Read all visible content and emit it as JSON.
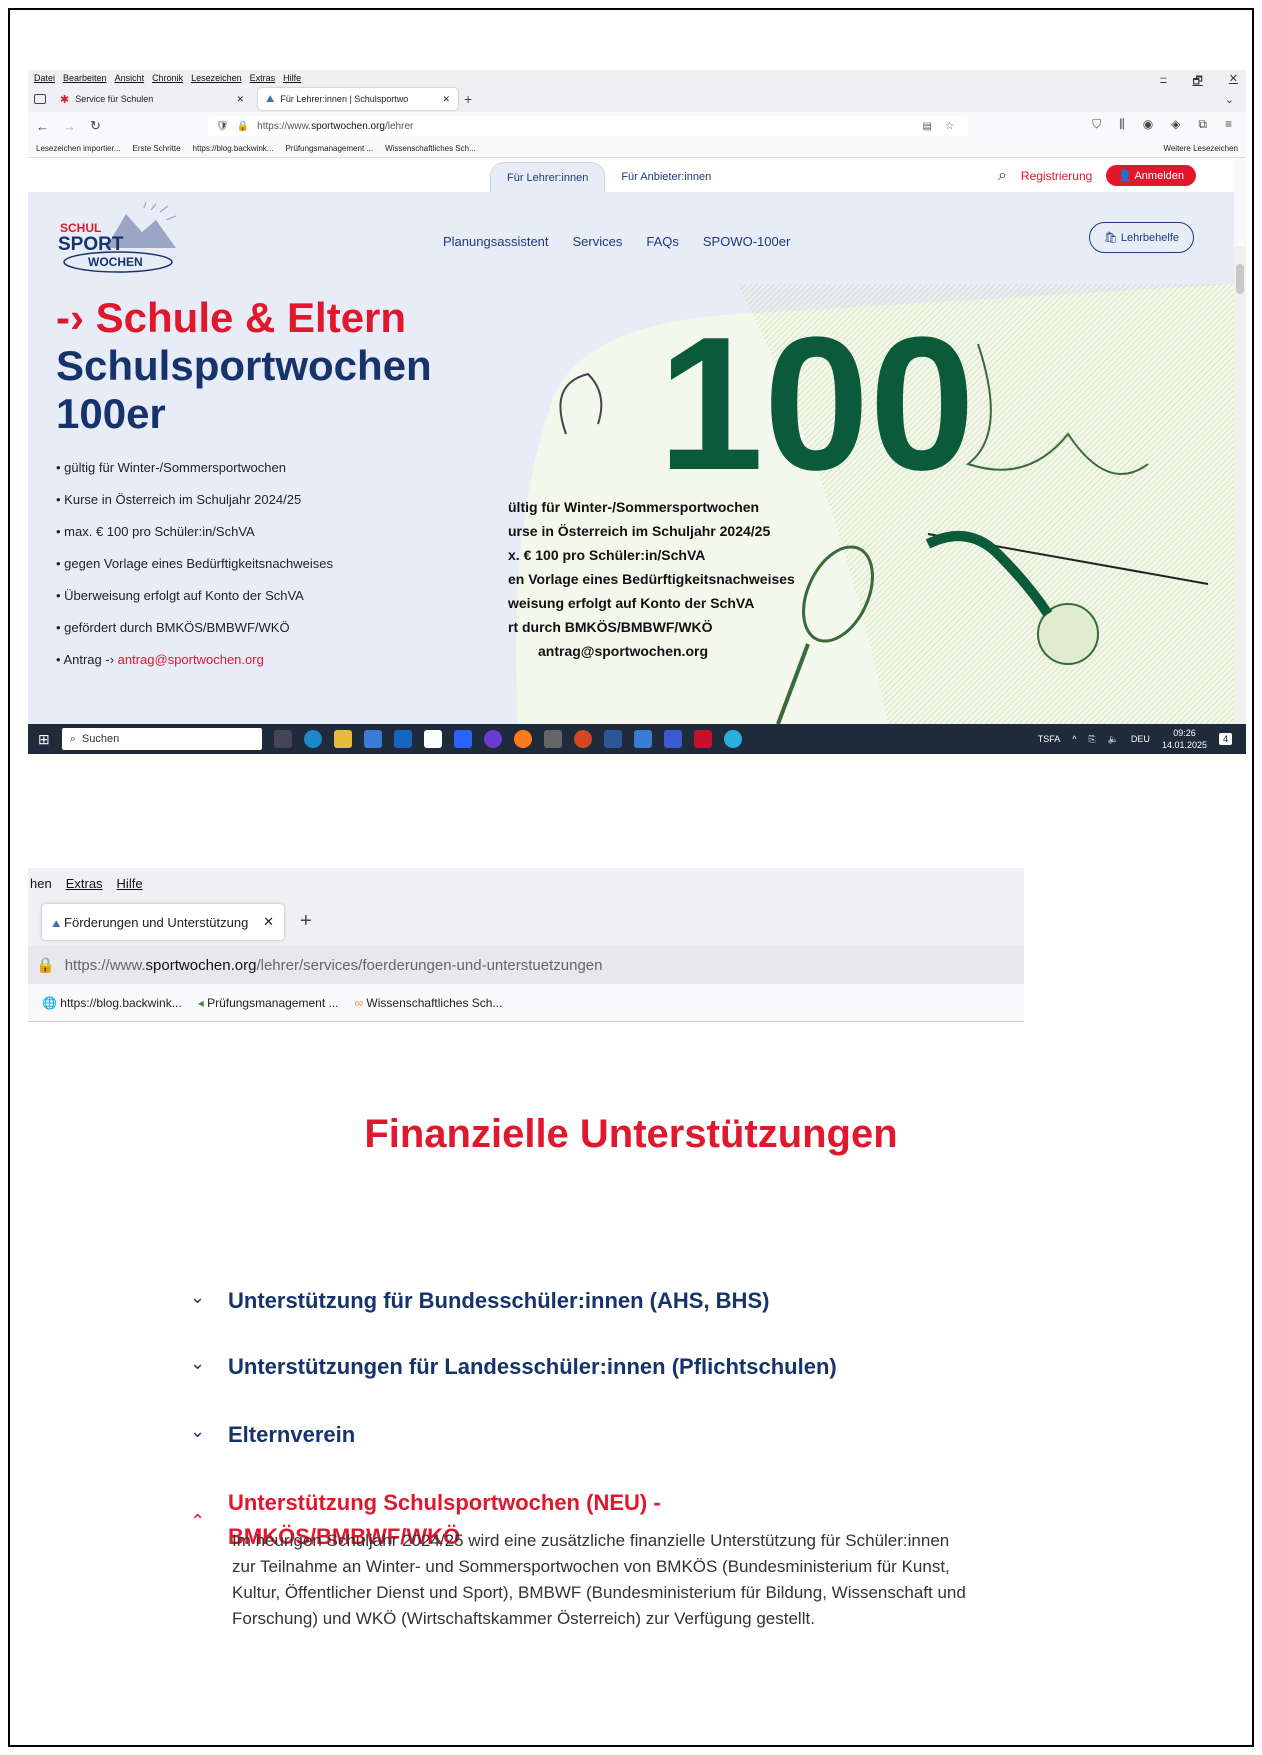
{
  "shot1": {
    "menu": [
      "Datei",
      "Bearbeiten",
      "Ansicht",
      "Chronik",
      "Lesezeichen",
      "Extras",
      "Hilfe"
    ],
    "window_controls": [
      "–",
      "🗗",
      "✕"
    ],
    "tabs": [
      {
        "label": "Service für Schulen"
      },
      {
        "label": "Für Lehrer:innen | Schulsportwo"
      }
    ],
    "url_prefix": "https://www.",
    "url_domain": "sportwochen.org",
    "url_path": "/lehrer",
    "bookmarks": [
      "Lesezeichen importier...",
      "Erste Schritte",
      "https://blog.backwink...",
      "Prüfungsmanagement ...",
      "Wissenschaftliches Sch..."
    ],
    "bookmarks_more": "Weitere Lesezeichen",
    "site": {
      "segment_active": "Für Lehrer:innen",
      "segment_other": "Für Anbieter:innen",
      "register": "Registrierung",
      "login": "Anmelden",
      "logo_line1": "SCHUL",
      "logo_line2": "SPORT",
      "logo_line3": "WOCHEN",
      "nav": [
        "Planungsassistent",
        "Services",
        "FAQs",
        "SPOWO-100er"
      ],
      "lehrbehelfe": "Lehrbehelfe",
      "hero_red": "-› Schule & Eltern",
      "hero_blue_1": "Schulsportwochen",
      "hero_blue_2": "100er",
      "bullets": [
        "gültig für Winter-/Sommersportwochen",
        "Kurse in Österreich im Schuljahr 2024/25",
        "max. € 100 pro Schüler:in/SchVA",
        "gegen Vorlage eines Bedürftigkeitsnachweises",
        "Überweisung erfolgt auf Konto der SchVA",
        "gefördert durch BMKÖS/BMBWF/WKÖ"
      ],
      "bullet_last_prefix": "Antrag -› ",
      "bullet_last_link": "antrag@sportwochen.org",
      "voucher_number": "100",
      "voucher_lines": [
        "ültig für Winter-/Sommersportwochen",
        "urse in Österreich im Schuljahr 2024/25",
        "x. € 100 pro Schüler:in/SchVA",
        "en Vorlage eines Bedürftigkeitsnachweises",
        "weisung erfolgt auf Konto der SchVA",
        "rt durch BMKÖS/BMBWF/WKÖ",
        "antrag@sportwochen.org"
      ]
    },
    "taskbar": {
      "search": "Suchen",
      "tray_label": "TSFA",
      "lang": "DEU",
      "time": "09:26",
      "date": "14.01.2025",
      "notif": "4"
    }
  },
  "shot2": {
    "menu": [
      "hen",
      "Extras",
      "Hilfe"
    ],
    "tab_label": "Förderungen und Unterstützung",
    "url_prefix": "https://www.",
    "url_domain": "sportwochen.org",
    "url_path": "/lehrer/services/foerderungen-und-unterstuetzungen",
    "bookmarks": [
      "https://blog.backwink...",
      "Prüfungsmanagement ...",
      "Wissenschaftliches Sch..."
    ],
    "title": "Finanzielle Unterstützungen",
    "accordion": [
      {
        "label": "Unterstützung für Bundesschüler:innen (AHS, BHS)",
        "open": false
      },
      {
        "label": "Unterstützungen für Landesschüler:innen (Pflichtschulen)",
        "open": false
      },
      {
        "label": "Elternverein",
        "open": false
      },
      {
        "label": "Unterstützung Schulsportwochen (NEU) - BMKÖS/BMBWF/WKÖ",
        "open": true
      }
    ],
    "open_body": "Im heurigen Schuljahr 2024/25 wird eine zusätzliche finanzielle Unterstützung für Schüler:innen zur Teilnahme an Winter- und Sommersportwochen von BMKÖS (Bundesministerium für Kunst, Kultur, Öffentlicher Dienst und Sport), BMBWF (Bundesministerium für Bildung, Wissenschaft und Forschung) und WKÖ (Wirtschaftskammer Österreich) zur Verfügung gestellt."
  },
  "colors": {
    "brand_red": "#e0182d",
    "brand_blue": "#16336b",
    "site_bg": "#e7ecf6"
  }
}
